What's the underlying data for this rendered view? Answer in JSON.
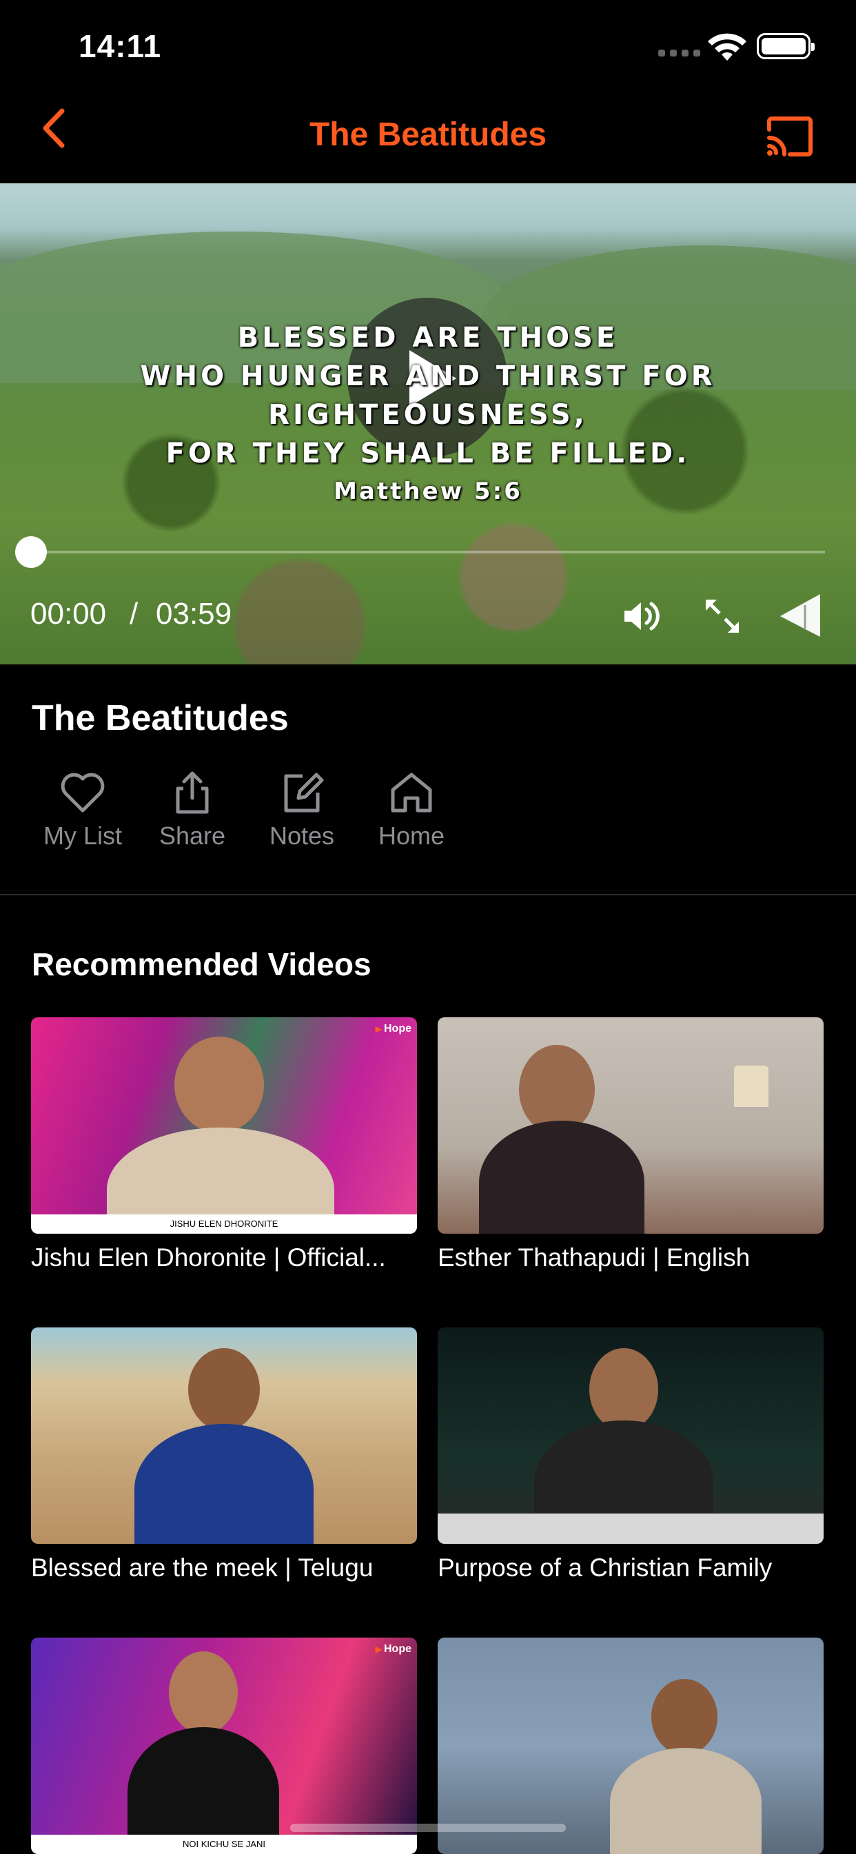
{
  "status_bar": {
    "time": "14:11"
  },
  "nav": {
    "title": "The Beatitudes",
    "accent": "#ff5a1f"
  },
  "player": {
    "verse_lines": [
      "BLESSED ARE THOSE",
      "WHO HUNGER AND THIRST FOR RIGHTEOUSNESS,",
      "FOR THEY SHALL BE FILLED."
    ],
    "verse_ref": "Matthew 5:6",
    "current_time": "00:00",
    "separator": "/",
    "total_time": "03:59",
    "progress": 0
  },
  "video": {
    "title": "The Beatitudes"
  },
  "actions": [
    {
      "label": "My List",
      "icon": "heart-icon"
    },
    {
      "label": "Share",
      "icon": "share-icon"
    },
    {
      "label": "Notes",
      "icon": "edit-icon"
    },
    {
      "label": "Home",
      "icon": "home-icon"
    }
  ],
  "recommended": {
    "heading": "Recommended Videos",
    "items": [
      {
        "title": "Jishu Elen Dhoronite | Official...",
        "badge": "Hope",
        "caption": "JISHU ELEN DHORONITE"
      },
      {
        "title": "Esther Thathapudi | English"
      },
      {
        "title": "Blessed are the meek | Telugu"
      },
      {
        "title": "Purpose of a Christian Family"
      },
      {
        "title": "",
        "badge": "Hope",
        "caption": "NOI KICHU SE JANI"
      },
      {
        "title": ""
      }
    ]
  }
}
